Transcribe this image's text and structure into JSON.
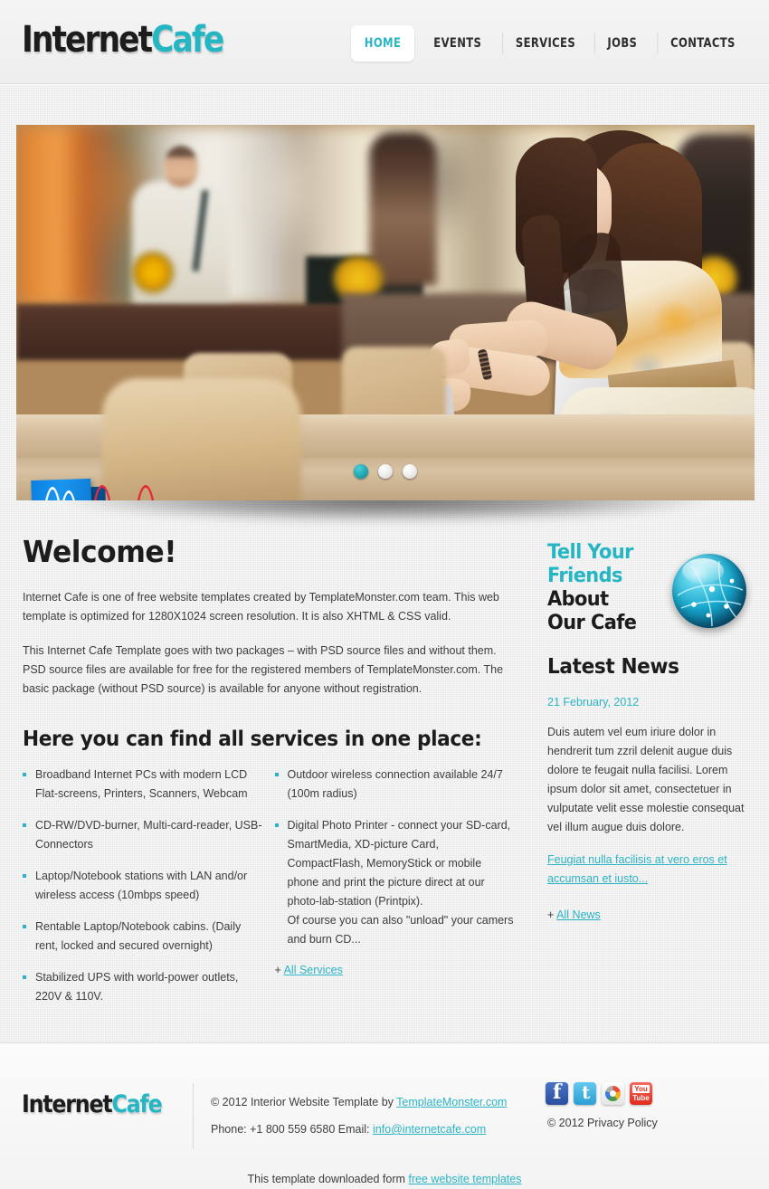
{
  "brand": {
    "part1": "Internet",
    "part2": "Cafe"
  },
  "nav": {
    "items": [
      {
        "label": "HOME",
        "active": true
      },
      {
        "label": "EVENTS",
        "active": false
      },
      {
        "label": "SERVICES",
        "active": false
      },
      {
        "label": "JOBS",
        "active": false
      },
      {
        "label": "CONTACTS",
        "active": false
      }
    ]
  },
  "slider": {
    "slide_count": 3,
    "active_index": 0,
    "alt": "Young woman with curly dark hair using a laptop at a wooden table in a shopping-mall cafe, blue shopping bag in the foreground"
  },
  "welcome": {
    "heading": "Welcome!",
    "paragraph1": "Internet Cafe is one of free website templates created by TemplateMonster.com team. This web template is optimized for 1280X1024 screen resolution. It is also XHTML & CSS valid.",
    "paragraph2": "This Internet Cafe Template goes with two packages – with PSD source files and without them. PSD source files are available for free for the registered members of TemplateMonster.com. The basic package (without PSD source) is available for anyone without registration."
  },
  "promo": {
    "line1": "Tell Your",
    "line2": "Friends",
    "line3": "About",
    "line4": "Our Cafe",
    "icon": "network-globe-icon",
    "accent": "#25b6c4"
  },
  "services": {
    "heading": "Here you can find all services in one place:",
    "column1": [
      "Broadband Internet PCs with modern LCD Flat-screens, Printers, Scanners, Webcam",
      "CD-RW/DVD-burner, Multi-card-reader, USB-Connectors",
      "Laptop/Notebook stations with LAN and/or wireless access (10mbps speed)",
      "Rentable Laptop/Notebook cabins. (Daily rent, locked and secured overnight)",
      "Stabilized UPS with world-power outlets, 220V & 110V."
    ],
    "column2": [
      "Outdoor wireless connection available 24/7 (100m radius)",
      "Digital Photo Printer - connect your SD-card, SmartMedia, XD-picture Card, CompactFlash, MemoryStick or mobile phone and print the picture direct at our photo-lab-station (Printpix).\nOf course you can also \"unload\" your camers and burn CD..."
    ],
    "more_prefix": "+ ",
    "more_label": "All Services"
  },
  "news": {
    "heading": "Latest News",
    "date": "21 February, 2012",
    "body": "Duis autem vel eum iriure dolor in hendrerit tum zzril delenit augue duis dolore te feugait nulla facilisi. Lorem ipsum dolor sit amet, consectetuer in vulputate velit esse molestie consequat vel illum augue duis dolore.",
    "read_more": "Feugiat nulla facilisis at vero eros et accumsan et iusto...",
    "more_prefix": "+ ",
    "more_label": "All News"
  },
  "footer": {
    "copyright_prefix": "© 2012 Interior Website Template by ",
    "copyright_link": "TemplateMonster.com",
    "phone_label": "Phone: +1 800 559 6580 Email: ",
    "email": "info@internetcafe.com",
    "privacy": "© 2012 Privacy Policy",
    "social": [
      {
        "name": "facebook-icon"
      },
      {
        "name": "twitter-icon"
      },
      {
        "name": "picasa-icon"
      },
      {
        "name": "youtube-icon"
      }
    ],
    "youtube_line1": "You",
    "youtube_line2": "Tube",
    "bottom_text": "This template downloaded form ",
    "bottom_link": "free website templates"
  }
}
